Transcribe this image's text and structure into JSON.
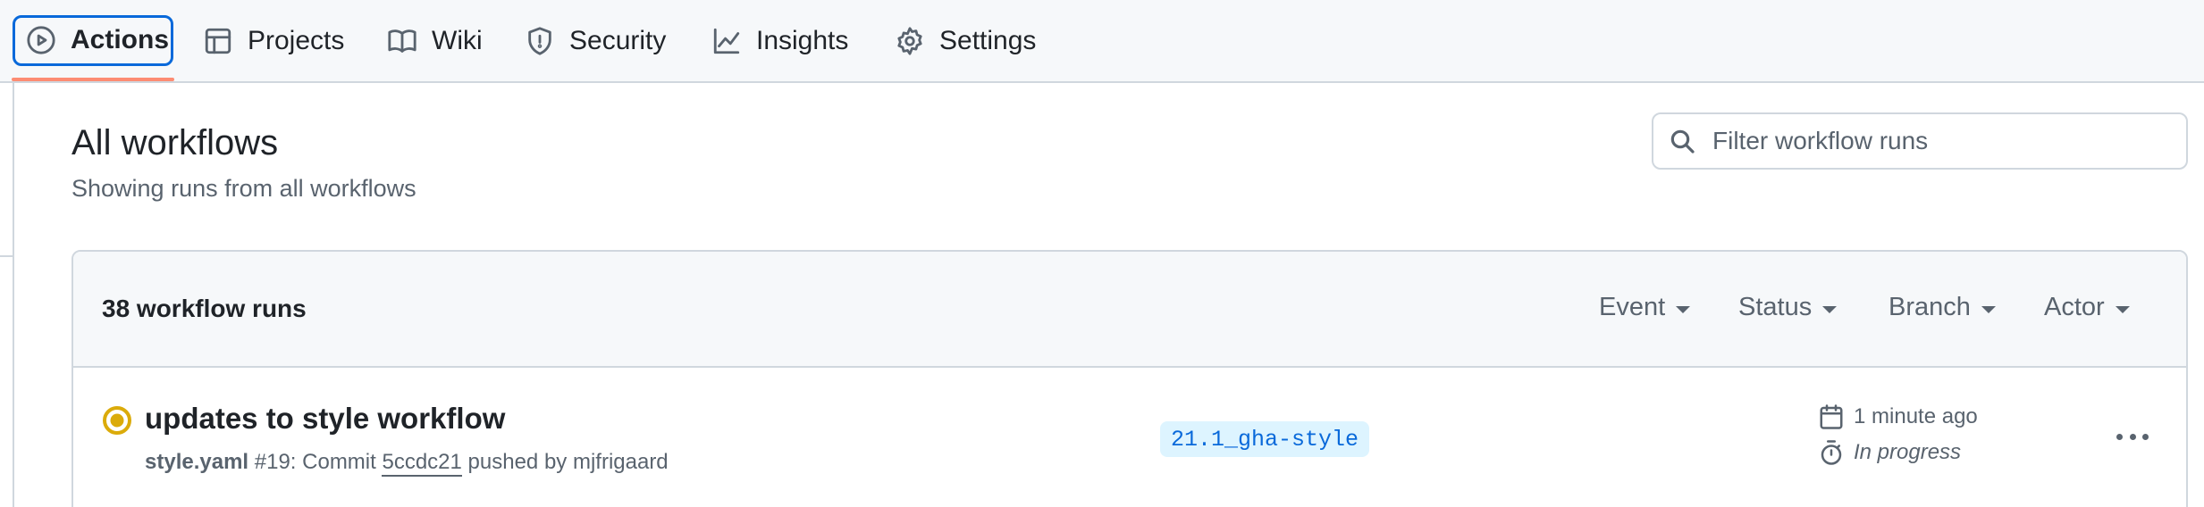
{
  "nav": {
    "tabs": [
      {
        "label": "Actions",
        "icon": "play-icon",
        "active": true
      },
      {
        "label": "Projects",
        "icon": "table-icon",
        "active": false
      },
      {
        "label": "Wiki",
        "icon": "book-icon",
        "active": false
      },
      {
        "label": "Security",
        "icon": "shield-icon",
        "active": false
      },
      {
        "label": "Insights",
        "icon": "graph-icon",
        "active": false
      },
      {
        "label": "Settings",
        "icon": "gear-icon",
        "active": false
      }
    ]
  },
  "header": {
    "title": "All workflows",
    "subtitle": "Showing runs from all workflows"
  },
  "search": {
    "placeholder": "Filter workflow runs",
    "value": ""
  },
  "runs": {
    "count_label": "38 workflow runs",
    "filters": [
      "Event",
      "Status",
      "Branch",
      "Actor"
    ],
    "items": [
      {
        "title": "updates to style workflow",
        "workflow_file": "style.yaml",
        "run_number": "#19",
        "commit_prefix": ": Commit",
        "commit_sha": "5ccdc21",
        "pushed_by": "pushed by mjfrigaard",
        "branch": "21.1_gha-style",
        "time_ago": "1 minute ago",
        "status": "In progress",
        "status_color": "#dbab0a"
      }
    ]
  },
  "colors": {
    "accent": "#0969da",
    "active_underline": "#fd8c73",
    "in_progress": "#dbab0a"
  }
}
